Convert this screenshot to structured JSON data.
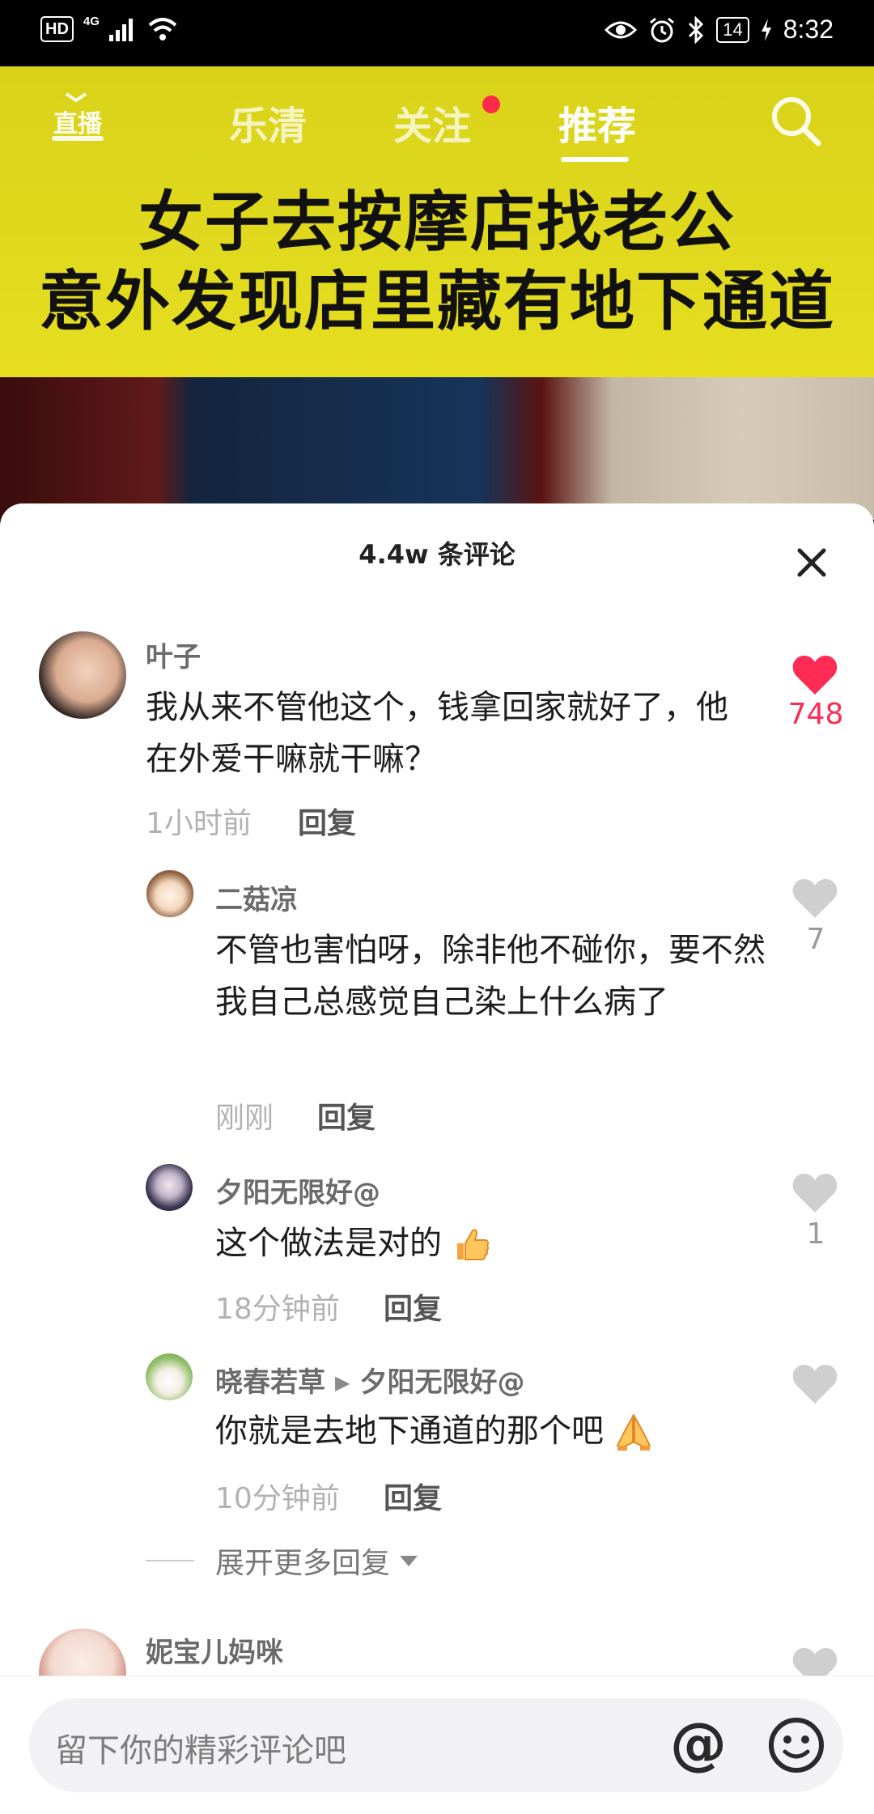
{
  "status_bar": {
    "hd": "HD",
    "network": "4G",
    "battery": "14",
    "time": "8:32"
  },
  "top_nav": {
    "live_label": "直播",
    "tabs": [
      {
        "label": "乐清",
        "active": false
      },
      {
        "label": "关注",
        "active": false,
        "has_dot": true
      },
      {
        "label": "推荐",
        "active": true
      }
    ],
    "search_icon": "search-icon"
  },
  "video": {
    "headline_line1": "女子去按摩店找老公",
    "headline_line2": "意外发现店里藏有地下通道"
  },
  "comments_sheet": {
    "title": "4.4w 条评论",
    "comments": [
      {
        "name": "叶子",
        "text": "我从来不管他这个，钱拿回家就好了，他在外爱干嘛就干嘛？",
        "time": "1小时前",
        "reply_label": "回复",
        "likes": "748",
        "liked": true
      }
    ],
    "replies": [
      {
        "name": "二菇凉",
        "text": "不管也害怕呀，除非他不碰你，要不然我自己总感觉自己染上什么病了",
        "time": "刚刚",
        "reply_label": "回复",
        "likes": "7"
      },
      {
        "name": "夕阳无限好@",
        "text": "这个做法是对的",
        "emoji": "thumbs-up",
        "time": "18分钟前",
        "reply_label": "回复",
        "likes": "1"
      },
      {
        "name": "晓春若草",
        "reply_to": "夕阳无限好@",
        "text": "你就是去地下通道的那个吧",
        "emoji": "praying-hands",
        "time": "10分钟前",
        "reply_label": "回复",
        "likes": ""
      }
    ],
    "expand_more": "展开更多回复",
    "next_comment": {
      "name": "妮宝儿妈咪"
    }
  },
  "input": {
    "placeholder": "留下你的精彩评论吧",
    "at_symbol": "@"
  },
  "colors": {
    "like_red": "#fe2c55",
    "band_yellow": "#e3dc1e",
    "muted_gray": "#b2b2b2"
  }
}
